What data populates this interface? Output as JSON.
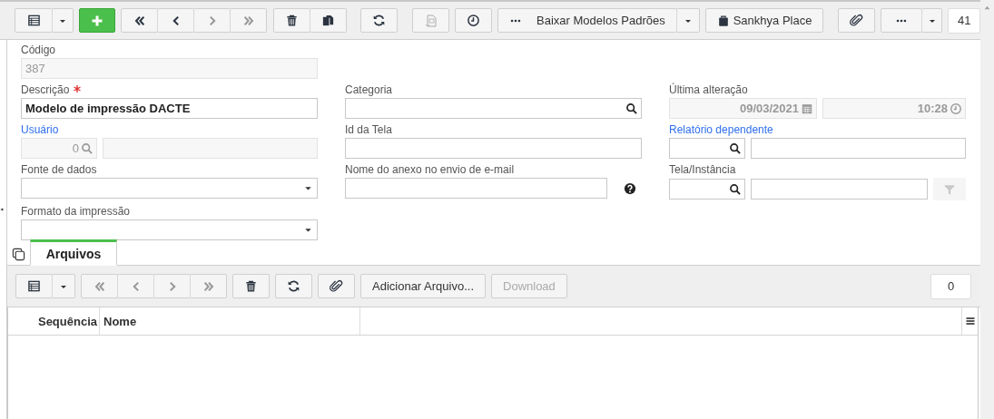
{
  "toolbar": {
    "nav_buttons": [
      {
        "disabled": false
      },
      {
        "disabled": false
      },
      {
        "disabled": true
      },
      {
        "disabled": true
      }
    ],
    "report_button": {
      "disabled": true
    },
    "action_button": "Baixar Modelos Padrões",
    "place_button": "Sankhya Place",
    "record_count": "41"
  },
  "form": {
    "rows": [
      [
        {
          "kind": "text",
          "label": "Código",
          "link": false,
          "required": false,
          "disabled": true,
          "value": "387"
        }
      ],
      [
        {
          "kind": "text",
          "label": "Descrição",
          "link": false,
          "required": true,
          "disabled": false,
          "value": "Modelo de impressão DACTE"
        },
        {
          "kind": "lookup",
          "label": "Categoria",
          "link": false,
          "required": false,
          "disabled": false
        },
        {
          "kind": "datetime",
          "label": "Última alteração",
          "link": false,
          "required": false,
          "disabled": true,
          "date": "09/03/2021",
          "time": "10:28"
        }
      ],
      [
        {
          "kind": "code_lookup",
          "label": "Usuário",
          "link": true,
          "required": false,
          "disabled": true,
          "code": "0"
        },
        {
          "kind": "text",
          "label": "Id da Tela",
          "link": false,
          "required": false,
          "disabled": false
        },
        {
          "kind": "code_lookup",
          "label": "Relatório dependente",
          "link": true,
          "required": false,
          "disabled": false
        }
      ],
      [
        {
          "kind": "select",
          "label": "Fonte de dados",
          "link": false,
          "required": false,
          "disabled": false
        },
        {
          "kind": "help_text",
          "label": "Nome do anexo no envio de e-mail",
          "link": false,
          "required": false,
          "disabled": false
        },
        {
          "kind": "code_filter",
          "label": "Tela/Instância",
          "link": false,
          "required": false,
          "disabled": false
        }
      ],
      [
        {
          "kind": "select",
          "label": "Formato da impressão",
          "link": false,
          "required": false,
          "disabled": false
        }
      ]
    ]
  },
  "tabs": [
    {
      "label": "Arquivos",
      "selected": true
    }
  ],
  "files": {
    "toolbar": {
      "nav_buttons": [
        {
          "disabled": true
        },
        {
          "disabled": true
        },
        {
          "disabled": true
        },
        {
          "disabled": true
        }
      ],
      "buttons": [
        {
          "label": "Adicionar Arquivo...",
          "disabled": false
        },
        {
          "label": "Download",
          "disabled": true
        }
      ],
      "record_count": "0"
    },
    "table": {
      "columns": [
        "Sequência",
        "Nome"
      ]
    }
  }
}
